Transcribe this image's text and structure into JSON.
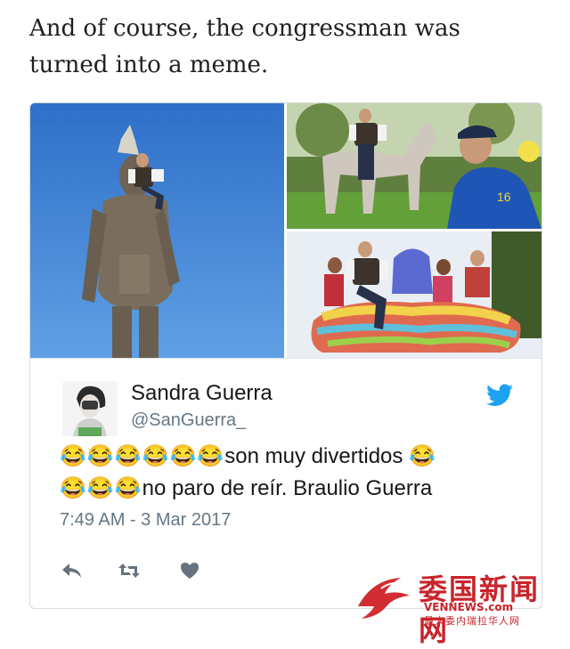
{
  "article": {
    "line1": "And of course, the congressman was",
    "line2": "turned into a meme."
  },
  "tweet": {
    "display_name": "Sandra Guerra",
    "handle": "@SanGuerra_",
    "emoji": "😂",
    "line1_emojis": "😂😂😂😂😂😂",
    "line1_text": "son muy divertidos ",
    "line1_trailing_emoji": "😂",
    "line2_emojis": "😂😂😂",
    "line2_text": "no paro de reír. Braulio Guerra",
    "timestamp": "7:49 AM - 3 Mar 2017",
    "icons": {
      "reply": "reply-icon",
      "retweet": "retweet-icon",
      "like": "heart-icon",
      "brand": "twitter-bird-icon"
    },
    "accent_color": "#1da1f2",
    "meta_color": "#657786"
  },
  "images": [
    {
      "name": "statue-meme-photo"
    },
    {
      "name": "pony-meme-photo"
    },
    {
      "name": "parade-float-meme-photo"
    }
  ],
  "watermark": {
    "title": "委国新闻网",
    "site": "VENNEWS.com",
    "subtitle": "最大委内瑞拉华人网"
  }
}
